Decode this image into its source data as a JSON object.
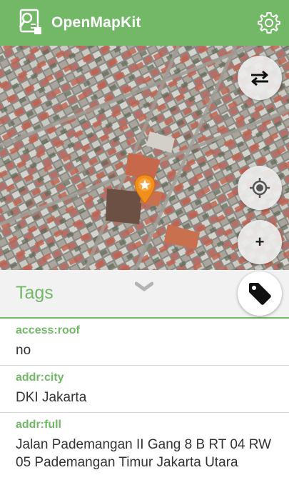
{
  "app": {
    "title": "OpenMapKit",
    "accent_color": "#72b867",
    "logo_icon": "openmapkit-logo-icon",
    "settings_icon": "gear-icon"
  },
  "map": {
    "swap_icon": "swap-arrows-icon",
    "locate_icon": "gps-locate-icon",
    "zoom_in_label": "+",
    "marker_icon": "star-map-pin-icon"
  },
  "tags_panel": {
    "title": "Tags",
    "collapse_icon": "chevron-down-icon",
    "tag_icon": "tag-icon",
    "items": [
      {
        "key": "access:roof",
        "value": "no"
      },
      {
        "key": "addr:city",
        "value": "DKI Jakarta"
      },
      {
        "key": "addr:full",
        "value": "Jalan Pademangan II Gang 8 B RT 04 RW 05 Pademangan Timur Jakarta Utara"
      }
    ]
  }
}
